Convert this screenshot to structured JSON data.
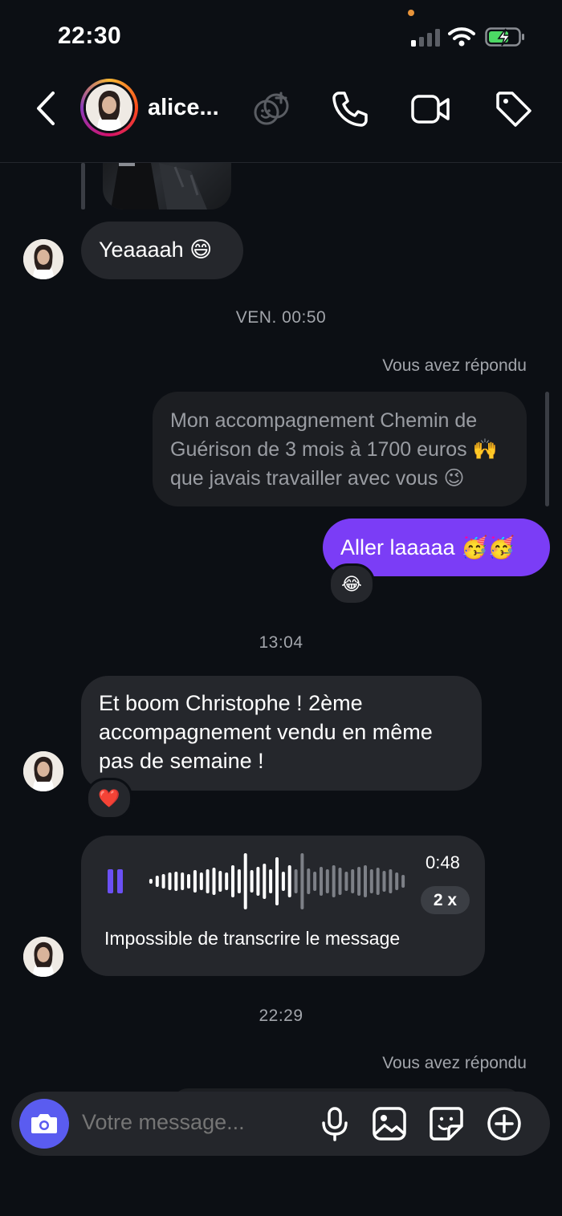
{
  "status_bar": {
    "time": "22:30"
  },
  "header": {
    "contact_name": "alice..."
  },
  "messages": {
    "msg1": "Yeaaaah 😄",
    "time1": "VEN. 00:50",
    "replied_label_1": "Vous avez répondu",
    "quoted_text": "Mon accompagnement Chemin de Guérison de 3 mois à 1700 euros 🙌 que javais travailler avec vous 😉",
    "sent_text": "Aller laaaaa 🥳🥳",
    "sent_reaction": "😂",
    "time2": "13:04",
    "msg2": "Et boom Christophe ! 2ème accompagnement vendu en même pas de semaine !",
    "msg2_reaction": "❤️",
    "voice": {
      "duration": "0:48",
      "speed": "2 x",
      "transcript": "Impossible de transcrire le message"
    },
    "time3": "22:29",
    "replied_label_2": "Vous avez répondu"
  },
  "composer": {
    "placeholder": "Votre message..."
  },
  "colors": {
    "accent_purple": "#7b3df6",
    "camera_blue": "#5a5cf0",
    "bubble_gray": "#25272c",
    "background": "#0c0f14"
  }
}
